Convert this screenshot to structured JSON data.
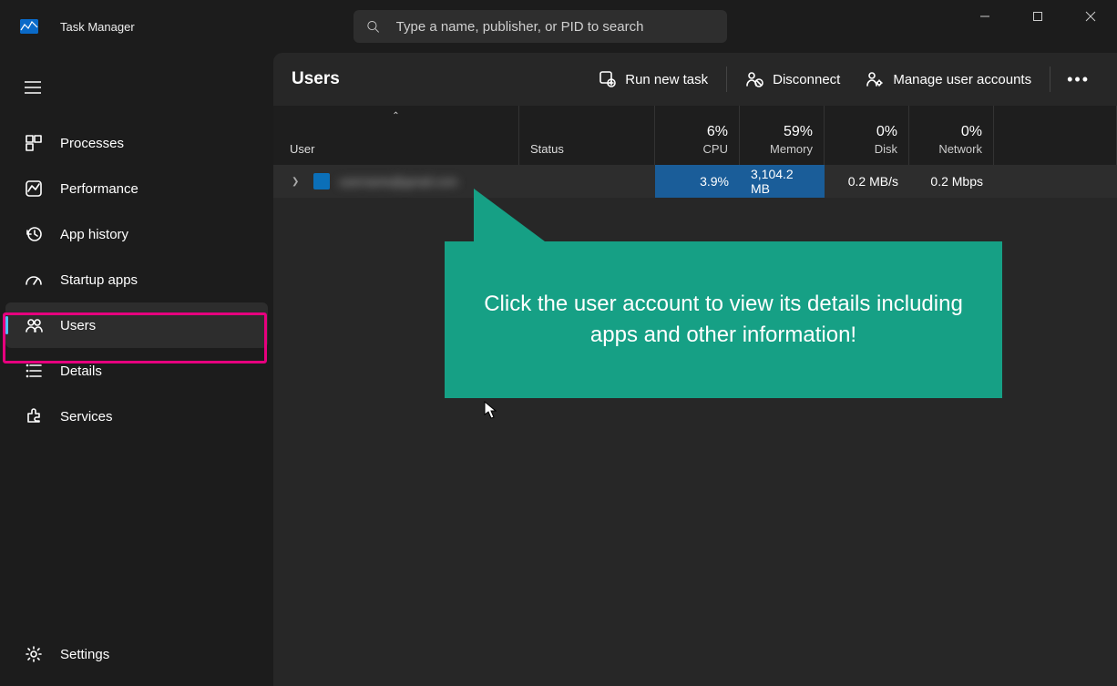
{
  "app": {
    "title": "Task Manager"
  },
  "search": {
    "placeholder": "Type a name, publisher, or PID to search"
  },
  "sidebar": {
    "items": [
      {
        "label": "Processes"
      },
      {
        "label": "Performance"
      },
      {
        "label": "App history"
      },
      {
        "label": "Startup apps"
      },
      {
        "label": "Users"
      },
      {
        "label": "Details"
      },
      {
        "label": "Services"
      }
    ],
    "settings_label": "Settings"
  },
  "main": {
    "title": "Users",
    "actions": {
      "run_new_task": "Run new task",
      "disconnect": "Disconnect",
      "manage_users": "Manage user accounts"
    }
  },
  "table": {
    "headers": {
      "user": "User",
      "status": "Status",
      "cpu": {
        "pct": "6%",
        "label": "CPU"
      },
      "memory": {
        "pct": "59%",
        "label": "Memory"
      },
      "disk": {
        "pct": "0%",
        "label": "Disk"
      },
      "network": {
        "pct": "0%",
        "label": "Network"
      }
    },
    "rows": [
      {
        "user_blurred": "username@gmail.com",
        "status": "",
        "cpu": "3.9%",
        "memory": "3,104.2 MB",
        "disk": "0.2 MB/s",
        "network": "0.2 Mbps"
      }
    ]
  },
  "callout": {
    "text": "Click the user account to view its details including apps and other information!"
  }
}
